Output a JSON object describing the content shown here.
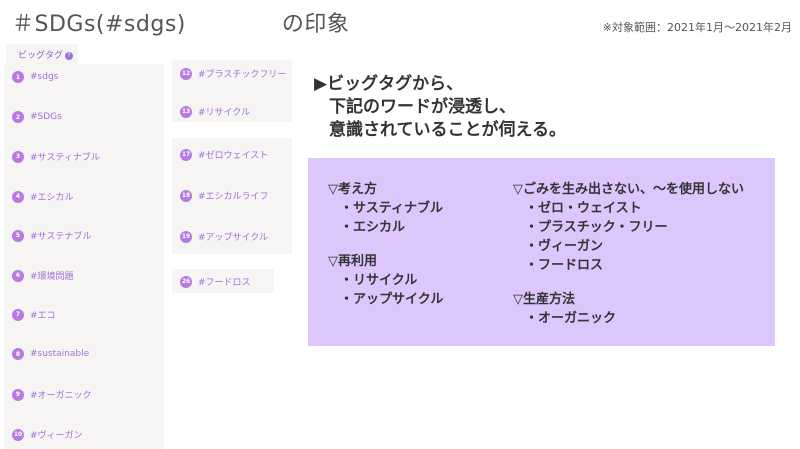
{
  "title": {
    "part1": "＃SDGs(#sdgs)",
    "part2": "の印象"
  },
  "range": "※対象範囲：2021年1月～2021年2月",
  "tab": {
    "label": "ビッグタグ",
    "help_glyph": "?"
  },
  "tags": [
    {
      "num": "1",
      "label": "#sdgs"
    },
    {
      "num": "2",
      "label": "#SDGs"
    },
    {
      "num": "3",
      "label": "#サスティナブル"
    },
    {
      "num": "4",
      "label": "#エシカル"
    },
    {
      "num": "5",
      "label": "#サステナブル"
    },
    {
      "num": "6",
      "label": "#環境問題"
    },
    {
      "num": "7",
      "label": "#エコ"
    },
    {
      "num": "8",
      "label": "#sustainable"
    },
    {
      "num": "9",
      "label": "#オーガニック"
    },
    {
      "num": "10",
      "label": "#ヴィーガン"
    },
    {
      "num": "12",
      "label": "#プラスチックフリー"
    },
    {
      "num": "13",
      "label": "#リサイクル"
    },
    {
      "num": "17",
      "label": "#ゼロウェイスト"
    },
    {
      "num": "18",
      "label": "#エシカルライフ"
    },
    {
      "num": "19",
      "label": "#アップサイクル"
    },
    {
      "num": "26",
      "label": "#フードロス"
    }
  ],
  "headline": {
    "line1": "▶ビッグタグから、",
    "line2": "下記のワードが浸透し、",
    "line3": "意識されていることが伺える。"
  },
  "summary": {
    "col1": [
      {
        "heading": "▽考え方",
        "items": [
          "・サスティナブル",
          "・エシカル"
        ]
      },
      {
        "heading": "▽再利用",
        "items": [
          "・リサイクル",
          "・アップサイクル"
        ]
      }
    ],
    "col2": [
      {
        "heading": "▽ごみを生み出さない、～を使用しない",
        "items": [
          "・ゼロ・ウェイスト",
          "・プラスチック・フリー",
          "・ヴィーガン",
          "・フードロス"
        ]
      },
      {
        "heading": "▽生産方法",
        "items": [
          "・オーガニック"
        ]
      }
    ]
  },
  "colors": {
    "accent": "#b57be0",
    "tag_text": "#a070d8",
    "panel_bg": "#f7f5f3",
    "summary_bg": "#dcc6fb"
  }
}
